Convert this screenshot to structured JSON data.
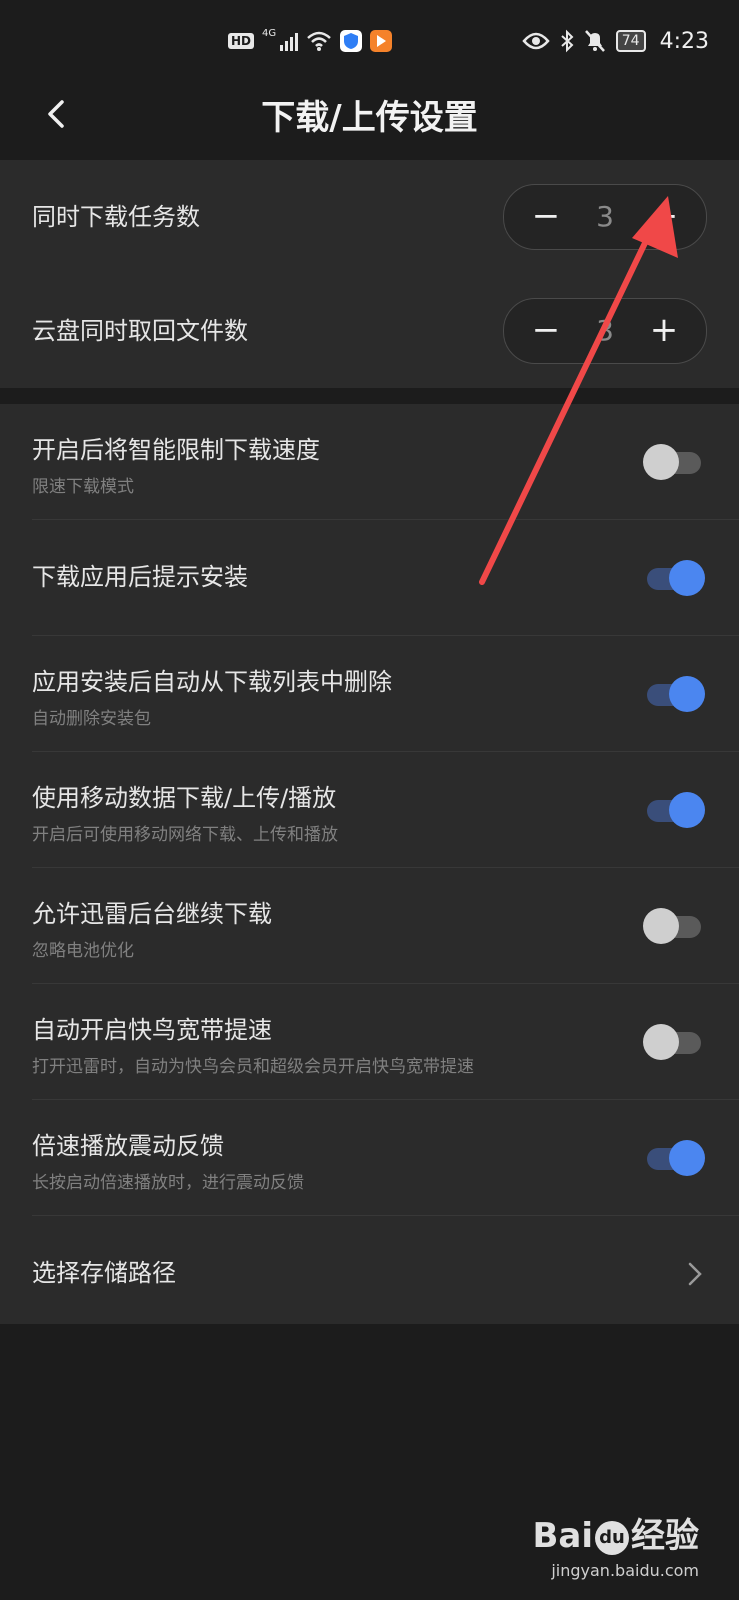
{
  "status_bar": {
    "hd": "HD",
    "network": "4G",
    "battery": "74",
    "time": "4:23",
    "icons": [
      "signal-icon",
      "wifi-icon",
      "shield-app-icon",
      "video-app-icon",
      "eye-icon",
      "bluetooth-icon",
      "bell-muted-icon"
    ]
  },
  "header": {
    "title": "下载/上传设置",
    "back_icon": "back-arrow-icon"
  },
  "steppers": [
    {
      "label": "同时下载任务数",
      "value": "3",
      "minus": "−",
      "plus": "+"
    },
    {
      "label": "云盘同时取回文件数",
      "value": "3",
      "minus": "−",
      "plus": "+"
    }
  ],
  "settings": [
    {
      "title": "开启后将智能限制下载速度",
      "subtitle": "限速下载模式",
      "on": false
    },
    {
      "title": "下载应用后提示安装",
      "subtitle": "",
      "on": true
    },
    {
      "title": "应用安装后自动从下载列表中删除",
      "subtitle": "自动删除安装包",
      "on": true
    },
    {
      "title": "使用移动数据下载/上传/播放",
      "subtitle": "开启后可使用移动网络下载、上传和播放",
      "on": true
    },
    {
      "title": "允许迅雷后台继续下载",
      "subtitle": "忽略电池优化",
      "on": false
    },
    {
      "title": "自动开启快鸟宽带提速",
      "subtitle": "打开迅雷时，自动为快鸟会员和超级会员开启快鸟宽带提速",
      "on": false
    },
    {
      "title": "倍速播放震动反馈",
      "subtitle": "长按启动倍速播放时，进行震动反馈",
      "on": true
    }
  ],
  "storage": {
    "title": "选择存储路径",
    "icon": "chevron-right-icon"
  },
  "colors": {
    "toggle_on": "#4b86f0",
    "toggle_off": "#cfcfcf",
    "annotation_arrow": "#f04848"
  },
  "watermark": {
    "logo": "Bai",
    "logo_mid": "du",
    "logo_suffix": "经验",
    "url": "jingyan.baidu.com"
  }
}
